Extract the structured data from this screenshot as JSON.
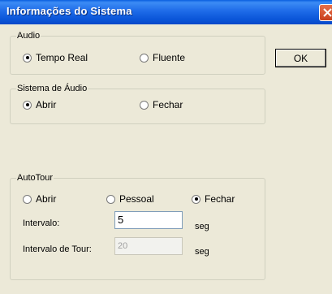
{
  "window": {
    "title": "Informações do Sistema"
  },
  "ok_button": "OK",
  "audio": {
    "legend": "Audio",
    "options": [
      {
        "label": "Tempo Real",
        "checked": true
      },
      {
        "label": "Fluente",
        "checked": false
      }
    ]
  },
  "sistema_audio": {
    "legend": "Sistema de Áudio",
    "options": [
      {
        "label": "Abrir",
        "checked": true
      },
      {
        "label": "Fechar",
        "checked": false
      }
    ]
  },
  "autotour": {
    "legend": "AutoTour",
    "options": [
      {
        "label": "Abrir",
        "checked": false
      },
      {
        "label": "Pessoal",
        "checked": false
      },
      {
        "label": "Fechar",
        "checked": true
      }
    ],
    "intervalo": {
      "label": "Intervalo:",
      "value": "5",
      "unit": "seg"
    },
    "intervalo_tour": {
      "label": "Intervalo de Tour:",
      "value": "20",
      "unit": "seg",
      "disabled": true
    }
  }
}
